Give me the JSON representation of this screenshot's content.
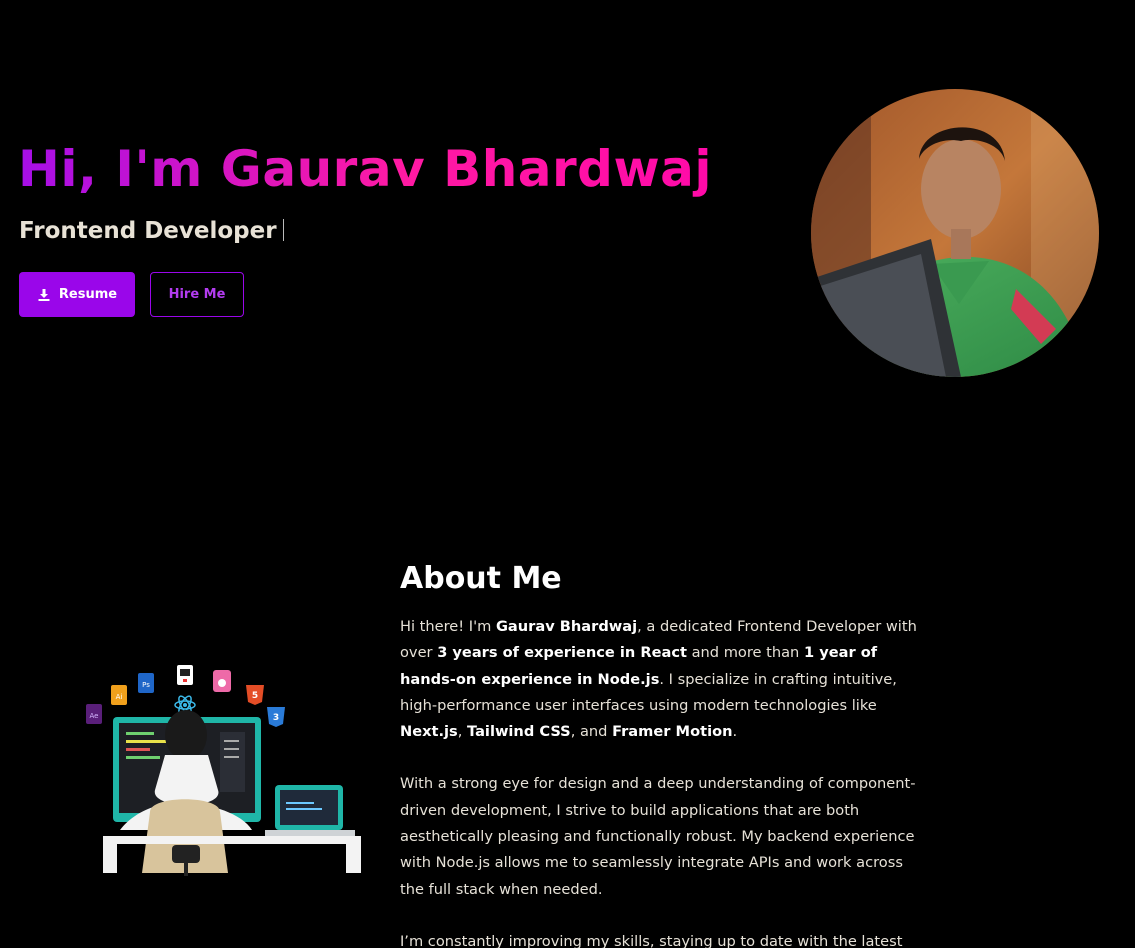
{
  "hero": {
    "title": "Hi, I'm Gaurav Bhardwaj",
    "role": "Frontend Developer",
    "resume_label": "Resume",
    "hire_label": "Hire Me"
  },
  "about": {
    "heading": "About Me",
    "p1": {
      "t1": "Hi there! I'm ",
      "b1": "Gaurav Bhardwaj",
      "t2": ", a dedicated Frontend Developer with over ",
      "b2": "3 years of experience in React",
      "t3": " and more than ",
      "b3": "1 year of hands-on experience in Node.js",
      "t4": ". I specialize in crafting intuitive, high-performance user interfaces using modern technologies like ",
      "b4": "Next.js",
      "t5": ", ",
      "b5": "Tailwind CSS",
      "t6": ", and ",
      "b6": "Framer Motion",
      "t7": "."
    },
    "p2": "With a strong eye for design and a deep understanding of component-driven development, I strive to build applications that are both aesthetically pleasing and functionally robust. My backend experience with Node.js allows me to seamlessly integrate APIs and work across the full stack when needed.",
    "p3": "I’m constantly improving my skills, staying up to date with the latest"
  },
  "colors": {
    "accent": "#9a06ea",
    "gradient_start": "#a60fe8",
    "gradient_end": "#ff0aa8",
    "background": "#000000"
  },
  "icons": {
    "resume": "download-icon",
    "illustration_icons": [
      "after-effects-icon",
      "illustrator-icon",
      "photoshop-icon",
      "code-file-icon",
      "figma-file-icon",
      "react-icon",
      "html5-icon",
      "css3-icon"
    ]
  }
}
